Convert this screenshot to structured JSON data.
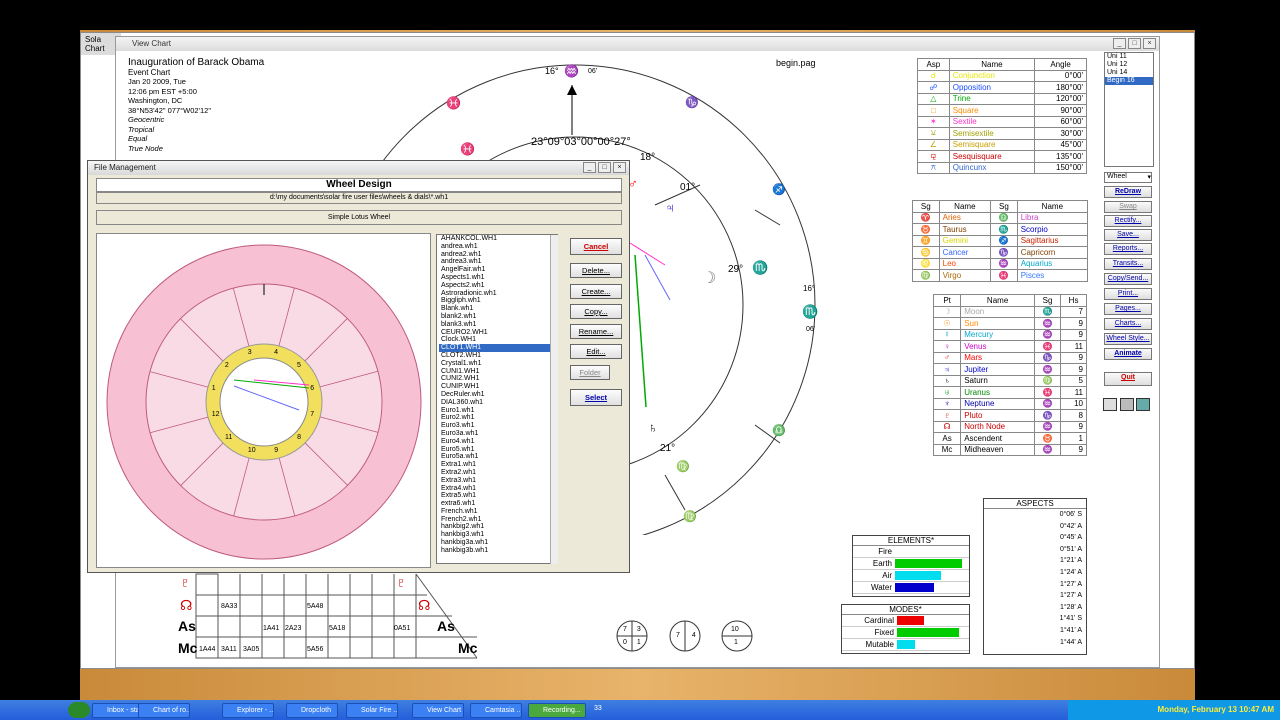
{
  "outer_window": {
    "title": "Sola",
    "menu": "Chart"
  },
  "chart_window": {
    "title": "View Chart",
    "page_label": "begin.pag"
  },
  "chart_info": {
    "title": "Inauguration of Barack Obama",
    "type": "Event Chart",
    "lines": [
      "Jan 20 2009, Tue",
      "12:06 pm  EST +5:00",
      "Washington, DC",
      "38°N53'42\" 077°W02'12\"",
      "Geocentric",
      "Tropical",
      "Equal",
      "True Node"
    ]
  },
  "wheel_labels": {
    "top_deg": "16°",
    "top_min": "06'",
    "cluster": "23°09°03°00°00°27°",
    "sun_deg": "01°",
    "jup_deg": "18°",
    "moon_deg": "29°",
    "node_deg": "21°",
    "right_16": "16°",
    "right_06": "06'",
    "ticks": [
      "16°",
      "06'",
      "16°",
      "06'",
      "16°",
      "06'",
      "16°",
      "16°",
      "06'",
      "06'"
    ]
  },
  "asp_table": {
    "headers": [
      "Asp",
      "Name",
      "Angle"
    ],
    "rows": [
      {
        "glyph": "☌",
        "name": "Conjunction",
        "angle": "0°00'",
        "color": "#e8e800"
      },
      {
        "glyph": "☍",
        "name": "Opposition",
        "angle": "180°00'",
        "color": "#1a4cff"
      },
      {
        "glyph": "△",
        "name": "Trine",
        "angle": "120°00'",
        "color": "#00aa00"
      },
      {
        "glyph": "□",
        "name": "Square",
        "angle": "90°00'",
        "color": "#ff8c00"
      },
      {
        "glyph": "✶",
        "name": "Sextile",
        "angle": "60°00'",
        "color": "#ff33cc"
      },
      {
        "glyph": "⚺",
        "name": "Semisextile",
        "angle": "30°00'",
        "color": "#a0a000"
      },
      {
        "glyph": "∠",
        "name": "Semisquare",
        "angle": "45°00'",
        "color": "#c8a000"
      },
      {
        "glyph": "⚼",
        "name": "Sesquisquare",
        "angle": "135°00'",
        "color": "#cc0000"
      },
      {
        "glyph": "⚻",
        "name": "Quincunx",
        "angle": "150°00'",
        "color": "#3366cc"
      }
    ]
  },
  "sign_table": {
    "headers": [
      "Sg",
      "Name",
      "Sg",
      "Name"
    ],
    "rows": [
      {
        "g1": "♈",
        "n1": "Aries",
        "c1": "#e06000",
        "g2": "♎",
        "n2": "Libra",
        "c2": "#cc44cc"
      },
      {
        "g1": "♉",
        "n1": "Taurus",
        "c1": "#804000",
        "g2": "♏",
        "n2": "Scorpio",
        "c2": "#0000cc"
      },
      {
        "g1": "♊",
        "n1": "Gemini",
        "c1": "#d8d800",
        "g2": "♐",
        "n2": "Sagittarius",
        "c2": "#cc2200"
      },
      {
        "g1": "♋",
        "n1": "Cancer",
        "c1": "#3366ff",
        "g2": "♑",
        "n2": "Capricorn",
        "c2": "#804000"
      },
      {
        "g1": "♌",
        "n1": "Leo",
        "c1": "#ff4400",
        "g2": "♒",
        "n2": "Aquarius",
        "c2": "#00aacc"
      },
      {
        "g1": "♍",
        "n1": "Virgo",
        "c1": "#aa6600",
        "g2": "♓",
        "n2": "Pisces",
        "c2": "#3377ff"
      }
    ]
  },
  "planet_table": {
    "headers": [
      "Pt",
      "Name",
      "Sg",
      "Hs"
    ],
    "rows": [
      {
        "g": "☽",
        "n": "Moon",
        "s": "♏",
        "h": "7",
        "c": "#aaaaaa"
      },
      {
        "g": "☉",
        "n": "Sun",
        "s": "♒",
        "h": "9",
        "c": "#ff8800"
      },
      {
        "g": "☿",
        "n": "Mercury",
        "s": "♒",
        "h": "9",
        "c": "#00aacc"
      },
      {
        "g": "♀",
        "n": "Venus",
        "s": "♓",
        "h": "11",
        "c": "#cc00cc"
      },
      {
        "g": "♂",
        "n": "Mars",
        "s": "♑",
        "h": "9",
        "c": "#ff0000"
      },
      {
        "g": "♃",
        "n": "Jupiter",
        "s": "♒",
        "h": "9",
        "c": "#0000cc"
      },
      {
        "g": "♄",
        "n": "Saturn",
        "s": "♍",
        "h": "5",
        "c": "#000000"
      },
      {
        "g": "♅",
        "n": "Uranus",
        "s": "♓",
        "h": "11",
        "c": "#008800"
      },
      {
        "g": "♆",
        "n": "Neptune",
        "s": "♒",
        "h": "10",
        "c": "#0000aa"
      },
      {
        "g": "♇",
        "n": "Pluto",
        "s": "♑",
        "h": "8",
        "c": "#cc0000"
      },
      {
        "g": "☊",
        "n": "North Node",
        "s": "♒",
        "h": "9",
        "c": "#cc0000"
      },
      {
        "g": "As",
        "n": "Ascendent",
        "s": "♉",
        "h": "1",
        "c": "#000000"
      },
      {
        "g": "Mc",
        "n": "Midheaven",
        "s": "♒",
        "h": "9",
        "c": "#000000"
      }
    ]
  },
  "aspects_box": {
    "title": "ASPECTS",
    "rows": [
      "0°06' S",
      "0°42' A",
      "0°45' A",
      "0°51' A",
      "1°21' A",
      "1°24' A",
      "1°27' A",
      "1°27' A",
      "1°28' A",
      "1°41' S",
      "1°41' A",
      "1°44' A"
    ]
  },
  "elements": {
    "title": "ELEMENTS*",
    "rows": [
      {
        "label": "Fire",
        "value": 0
      },
      {
        "label": "Earth",
        "value": 0.95
      },
      {
        "label": "Air",
        "value": 0.65
      },
      {
        "label": "Water",
        "value": 0.55
      }
    ]
  },
  "modes": {
    "title": "MODES*",
    "rows": [
      {
        "label": "Cardinal",
        "value": 0.42
      },
      {
        "label": "Fixed",
        "value": 0.95
      },
      {
        "label": "Mutable",
        "value": 0.27
      }
    ]
  },
  "pages_list": [
    "Uni 11",
    "Uni 12",
    "Uni 14",
    "Begin 16"
  ],
  "wheel_select": "Wheel",
  "side_buttons": [
    "ReDraw",
    "Swap",
    "Rectify...",
    "Save...",
    "Reports...",
    "Transits...",
    "Copy/Send...",
    "Print...",
    "Pages...",
    "Charts...",
    "Wheel Style...",
    "Animate",
    "Quit"
  ],
  "file_mgmt": {
    "title": "File Management",
    "heading": "Wheel Design",
    "path": "d:\\my documents\\solar fire user files\\wheels & dials\\*.wh1",
    "design_name": "Simple Lotus Wheel",
    "buttons": [
      "Cancel",
      "Delete...",
      "Create...",
      "Copy...",
      "Rename...",
      "Edit...",
      "Folder",
      "Select"
    ],
    "files": [
      "AHANKCOL.WH1",
      "andrea.wh1",
      "andrea2.wh1",
      "andrea3.wh1",
      "AngelFair.wh1",
      "Aspects1.wh1",
      "Aspects2.wh1",
      "Astroradionic.wh1",
      "Biggliph.wh1",
      "Blank.wh1",
      "blank2.wh1",
      "blank3.wh1",
      "CEURO2.WH1",
      "Clock.WH1",
      "CLOT1.WH1",
      "CLOT2.WH1",
      "Crystal1.wh1",
      "CUNI1.WH1",
      "CUNI2.WH1",
      "CUNIP.WH1",
      "DecRuler.wh1",
      "DIAL360.wh1",
      "Euro1.wh1",
      "Euro2.wh1",
      "Euro3.wh1",
      "Euro3a.wh1",
      "Euro4.wh1",
      "Euro5.wh1",
      "Euro5a.wh1",
      "Extra1.wh1",
      "Extra2.wh1",
      "Extra3.wh1",
      "Extra4.wh1",
      "Extra5.wh1",
      "extra6.wh1",
      "French.wh1",
      "French2.wh1",
      "hankbig2.wh1",
      "hankbig3.wh1",
      "hankbig3a.wh1",
      "hankbig3b.wh1"
    ],
    "selected_index": 14
  },
  "preview_wheel": {
    "houses": [
      "1",
      "2",
      "3",
      "4",
      "5",
      "6",
      "7",
      "8",
      "9",
      "10",
      "11",
      "12"
    ]
  },
  "grid_cells": [
    "8A33",
    "5A48",
    "1A41",
    "2A23",
    "5A18",
    "0A51",
    "1A44",
    "3A11",
    "3A05",
    "5A56"
  ],
  "grid_glyphs": [
    "♇",
    "☊",
    "As",
    "Mc",
    "♇",
    "☊",
    "As",
    "Mc"
  ],
  "dials": [
    {
      "top": "7 3",
      "bot": "0 1"
    },
    {
      "mid": "7 4"
    },
    {
      "top": "10",
      "bot": "1"
    }
  ],
  "taskbar": {
    "items": [
      "Inbox - sta...",
      "Chart of ro...",
      "Explorer - ...",
      "Dropcloth",
      "Solar Fire ...",
      "View Chart",
      "Camtasia ...",
      "Recording..."
    ],
    "clock": "Monday, February 13 10:47 AM",
    "quick": "33"
  }
}
